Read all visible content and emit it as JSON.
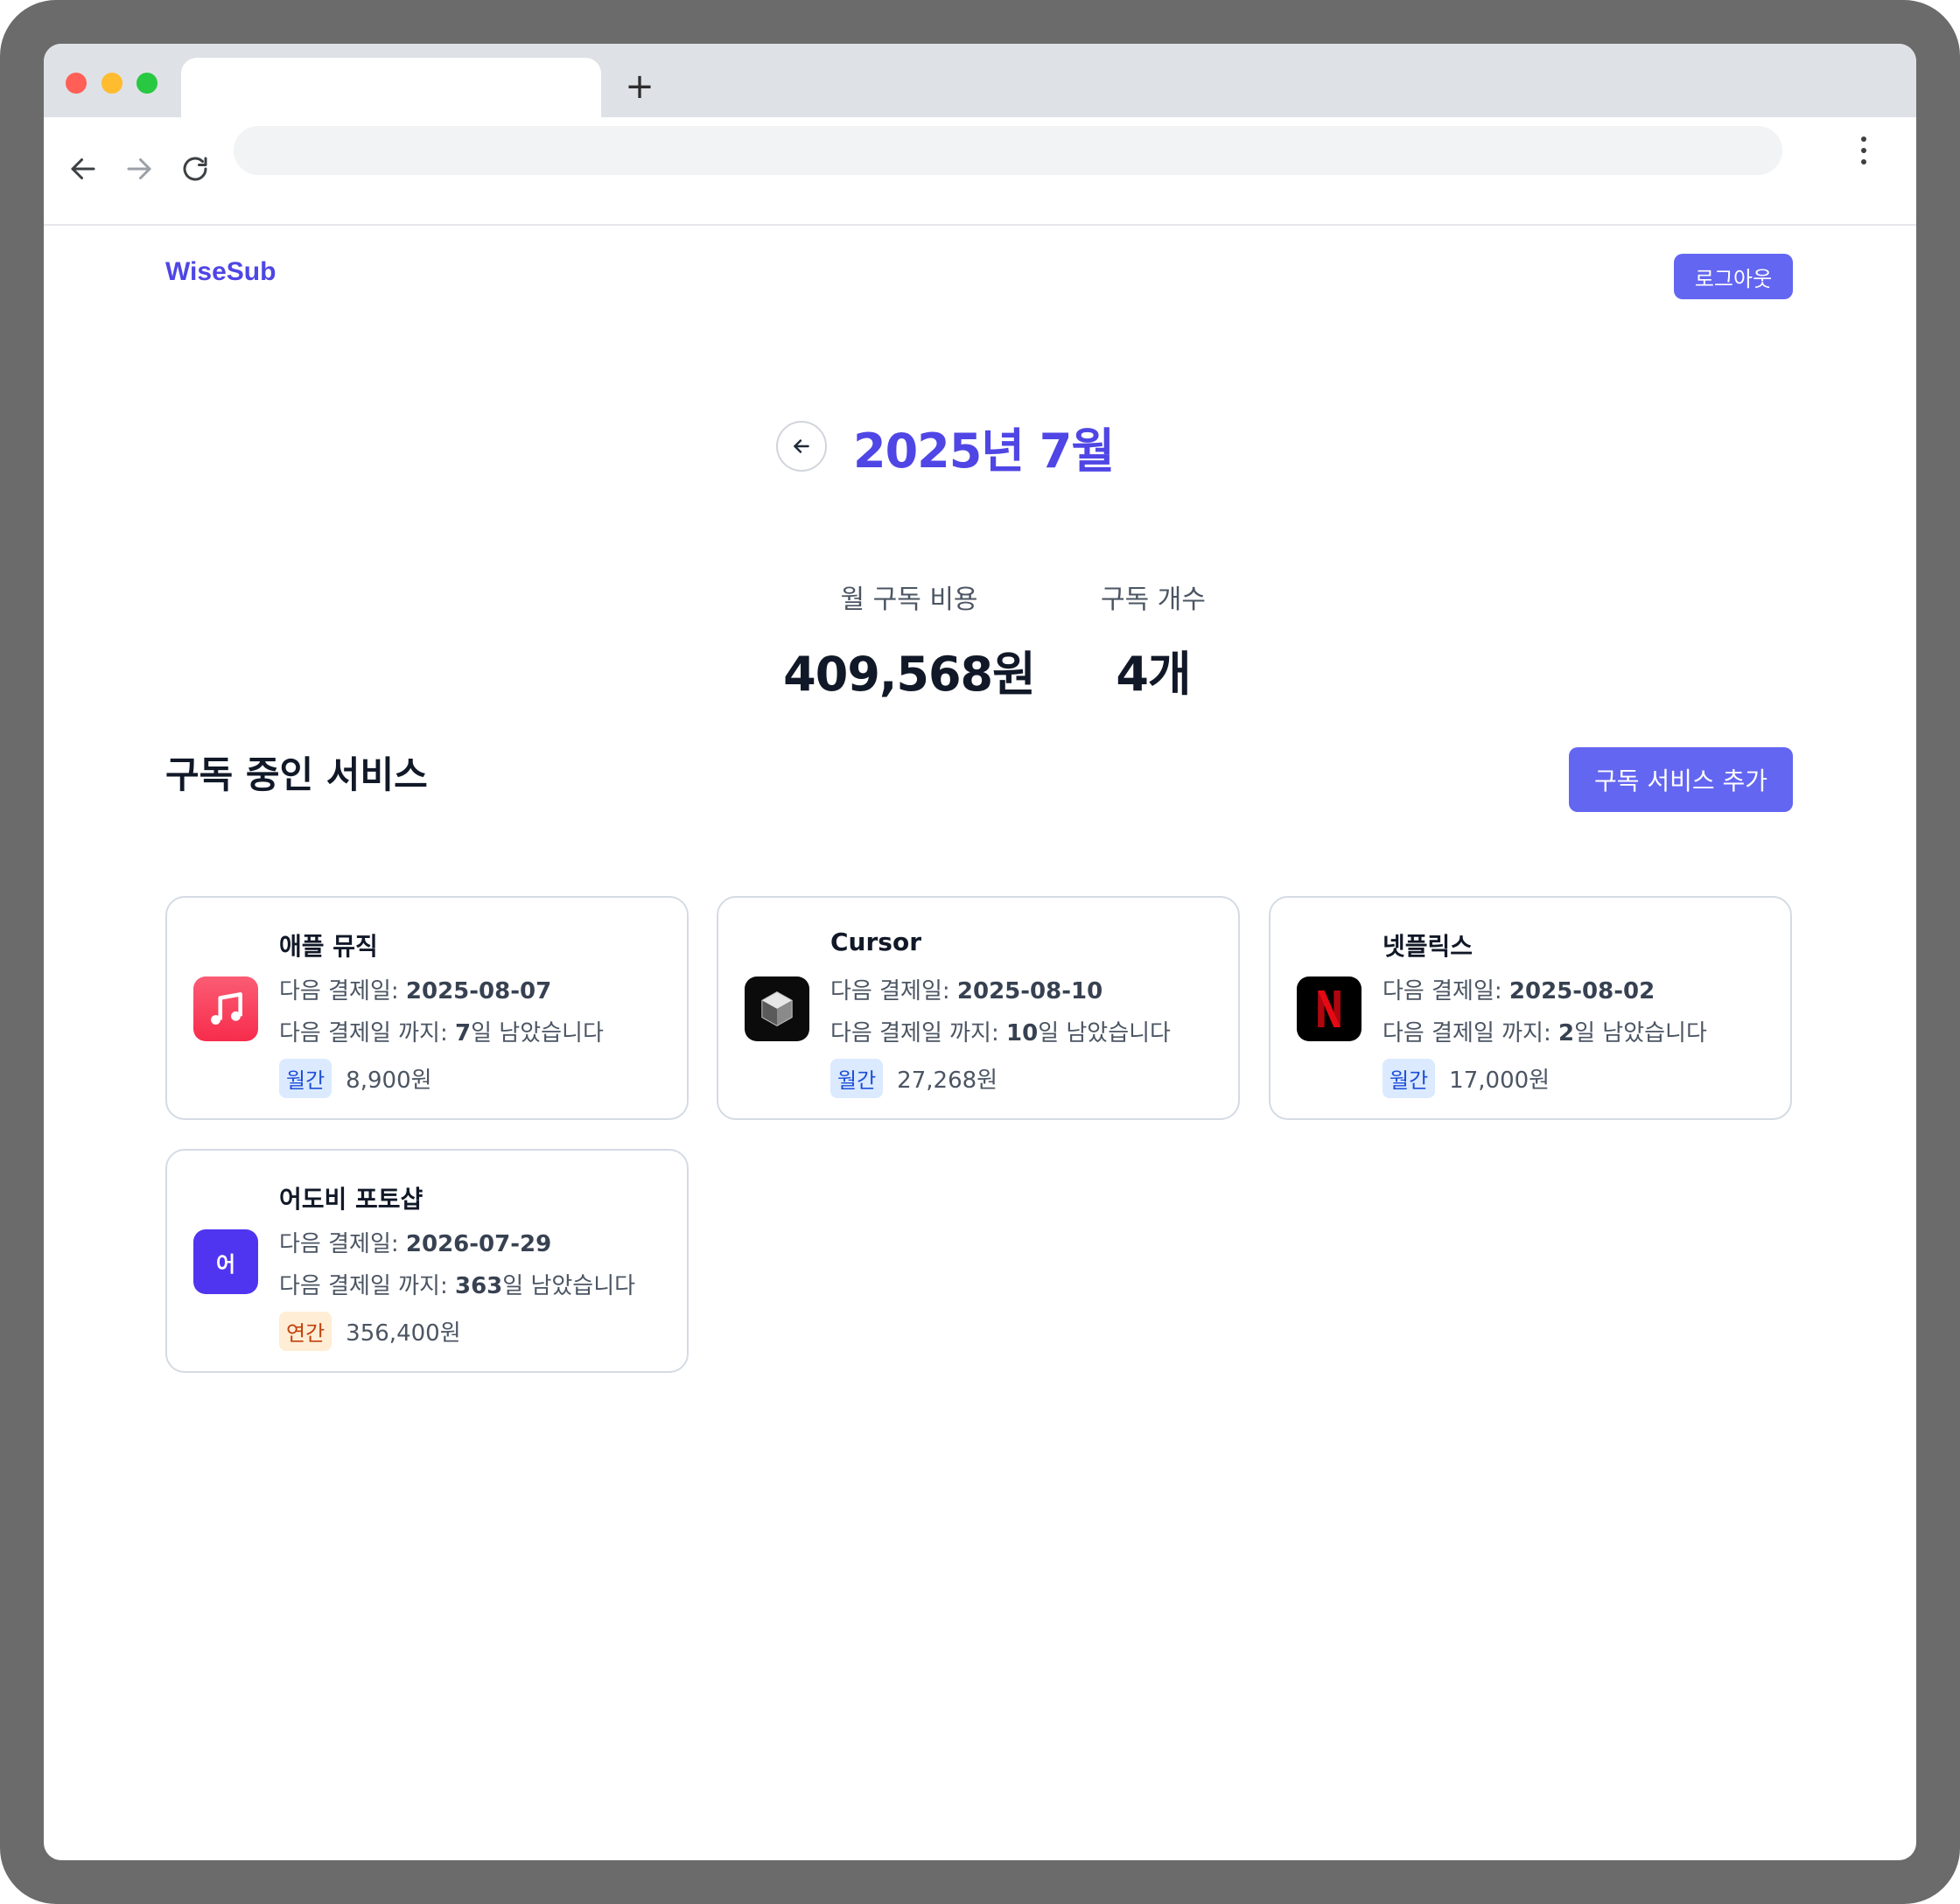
{
  "app": {
    "brand": "WiseSub",
    "logout_label": "로그아웃"
  },
  "header": {
    "month_title": "2025년 7월"
  },
  "stats": {
    "cost_label": "월 구독 비용",
    "cost_value": "409,568원",
    "count_label": "구독 개수",
    "count_value": "4개"
  },
  "section": {
    "title": "구독 중인 서비스",
    "add_label": "구독 서비스 추가"
  },
  "labels": {
    "next_pay": "다음 결제일: ",
    "until_prefix": "다음 결제일 까지: ",
    "until_suffix": "일 남았습니다"
  },
  "subscriptions": [
    {
      "name": "애플 뮤직",
      "next_date": "2025-08-07",
      "days_left": "7",
      "cycle": "월간",
      "price": "8,900원",
      "icon": "apple-music-icon"
    },
    {
      "name": "Cursor",
      "next_date": "2025-08-10",
      "days_left": "10",
      "cycle": "월간",
      "price": "27,268원",
      "icon": "cursor-icon"
    },
    {
      "name": "넷플릭스",
      "next_date": "2025-08-02",
      "days_left": "2",
      "cycle": "월간",
      "price": "17,000원",
      "icon": "netflix-icon"
    },
    {
      "name": "어도비 포토샵",
      "next_date": "2026-07-29",
      "days_left": "363",
      "cycle": "연간",
      "price": "356,400원",
      "icon": "letter-avatar-icon",
      "avatar_letter": "어"
    }
  ],
  "colors": {
    "accent": "#4f46e5",
    "button": "#6366f1",
    "monthly_badge": "#dbeafe",
    "yearly_badge": "#ffedd5"
  }
}
